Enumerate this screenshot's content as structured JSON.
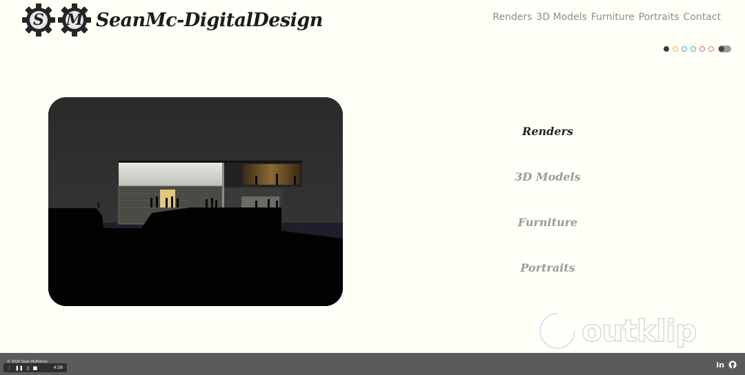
{
  "header": {
    "logo_letters": [
      "S",
      "M"
    ],
    "site_title": "SeanMc-DigitalDesign"
  },
  "topnav": {
    "items": [
      "Renders",
      "3D Models",
      "Furniture",
      "Portraits",
      "Contact"
    ]
  },
  "theme_dots": {
    "colors": [
      "#3b3b3b",
      "#e4b53b",
      "#3bb3c8",
      "#3bb39c",
      "#e0577a",
      "#d3814a"
    ]
  },
  "side_nav": {
    "items": [
      "Renders",
      "3D Models",
      "Furniture",
      "Portraits"
    ],
    "active": "Renders"
  },
  "watermark": {
    "text": "outklip"
  },
  "footer": {
    "copyright": "© 2020 Sean McMahon"
  },
  "player": {
    "time": "4:59"
  }
}
